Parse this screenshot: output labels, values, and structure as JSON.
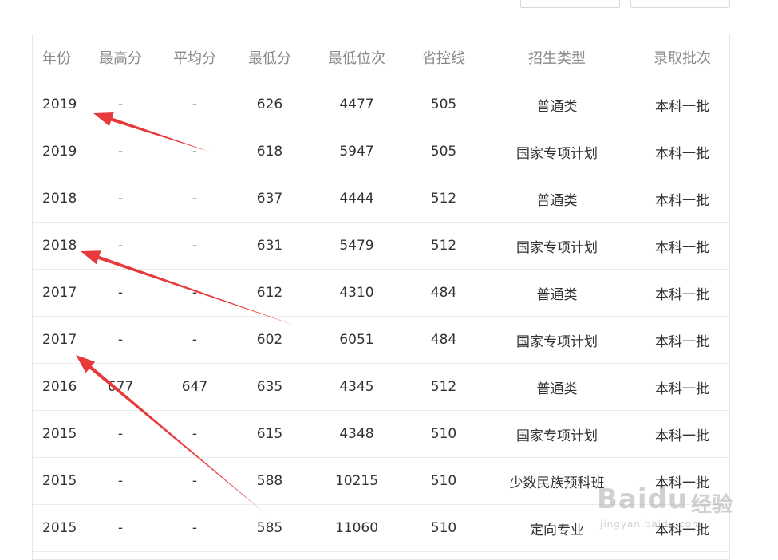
{
  "filters": [
    "",
    ""
  ],
  "table": {
    "headers": [
      "年份",
      "最高分",
      "平均分",
      "最低分",
      "最低位次",
      "省控线",
      "招生类型",
      "录取批次"
    ],
    "rows": [
      [
        "2019",
        "-",
        "-",
        "626",
        "4477",
        "505",
        "普通类",
        "本科一批"
      ],
      [
        "2019",
        "-",
        "-",
        "618",
        "5947",
        "505",
        "国家专项计划",
        "本科一批"
      ],
      [
        "2018",
        "-",
        "-",
        "637",
        "4444",
        "512",
        "普通类",
        "本科一批"
      ],
      [
        "2018",
        "-",
        "-",
        "631",
        "5479",
        "512",
        "国家专项计划",
        "本科一批"
      ],
      [
        "2017",
        "-",
        "-",
        "612",
        "4310",
        "484",
        "普通类",
        "本科一批"
      ],
      [
        "2017",
        "-",
        "-",
        "602",
        "6051",
        "484",
        "国家专项计划",
        "本科一批"
      ],
      [
        "2016",
        "677",
        "647",
        "635",
        "4345",
        "512",
        "普通类",
        "本科一批"
      ],
      [
        "2015",
        "-",
        "-",
        "615",
        "4348",
        "510",
        "国家专项计划",
        "本科一批"
      ],
      [
        "2015",
        "-",
        "-",
        "588",
        "10215",
        "510",
        "少数民族预科班",
        "本科一批"
      ],
      [
        "2015",
        "-",
        "-",
        "585",
        "11060",
        "510",
        "定向专业",
        "本科一批"
      ]
    ]
  },
  "annotation": {
    "arrow_color": "#e8393b"
  },
  "watermark": {
    "brand": "Baidu",
    "zh": "经验",
    "url": "jingyan.baidu.com"
  }
}
